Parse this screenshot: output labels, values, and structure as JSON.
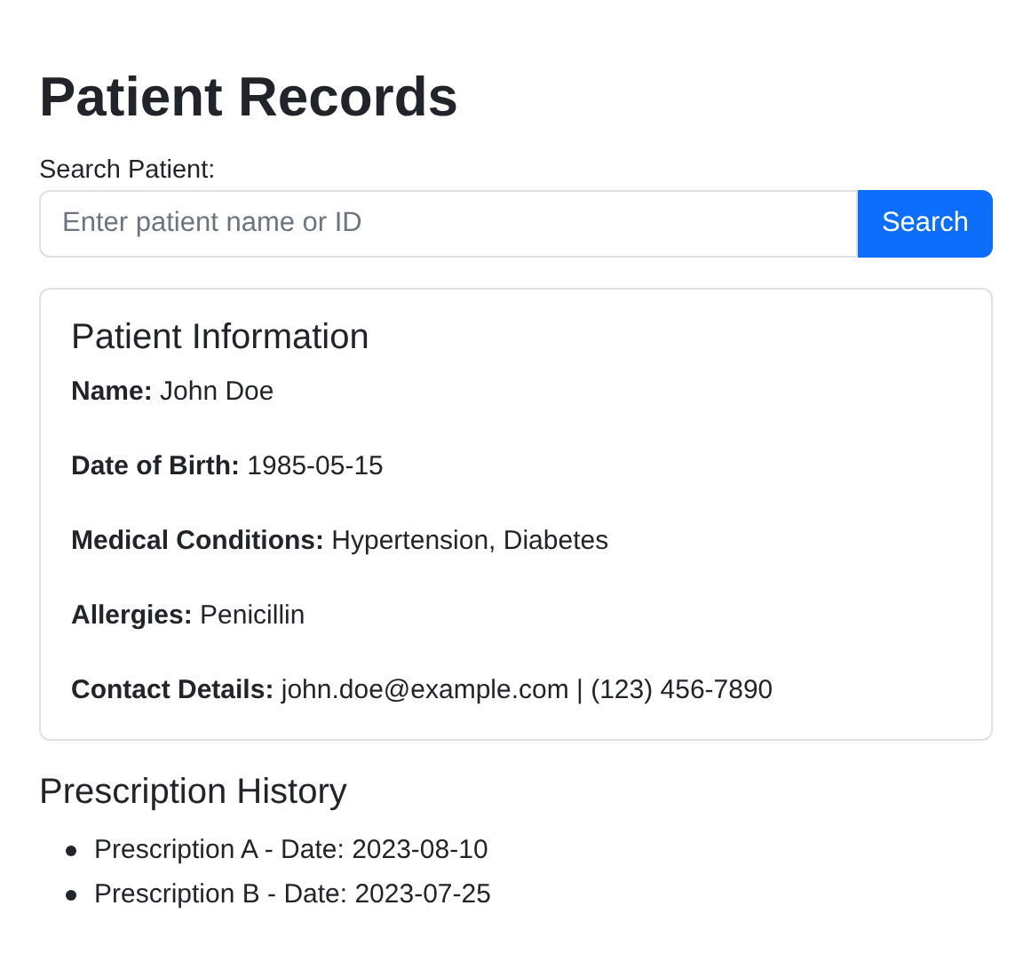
{
  "title": "Patient Records",
  "search": {
    "label": "Search Patient:",
    "placeholder": "Enter patient name or ID",
    "button": "Search"
  },
  "patient_card": {
    "title": "Patient Information",
    "fields": [
      "**Name:** John Doe",
      "**Date of Birth:** 1985-05-15",
      "**Medical Conditions:** Hypertension, Diabetes",
      "**Allergies:** Penicillin",
      "**Contact Details:** john.doe@example.com | (123) 456-7890"
    ]
  },
  "prescription_history": {
    "title": "Prescription History",
    "items": [
      "Prescription A - Date: 2023-08-10",
      "Prescription B - Date: 2023-07-25"
    ]
  }
}
